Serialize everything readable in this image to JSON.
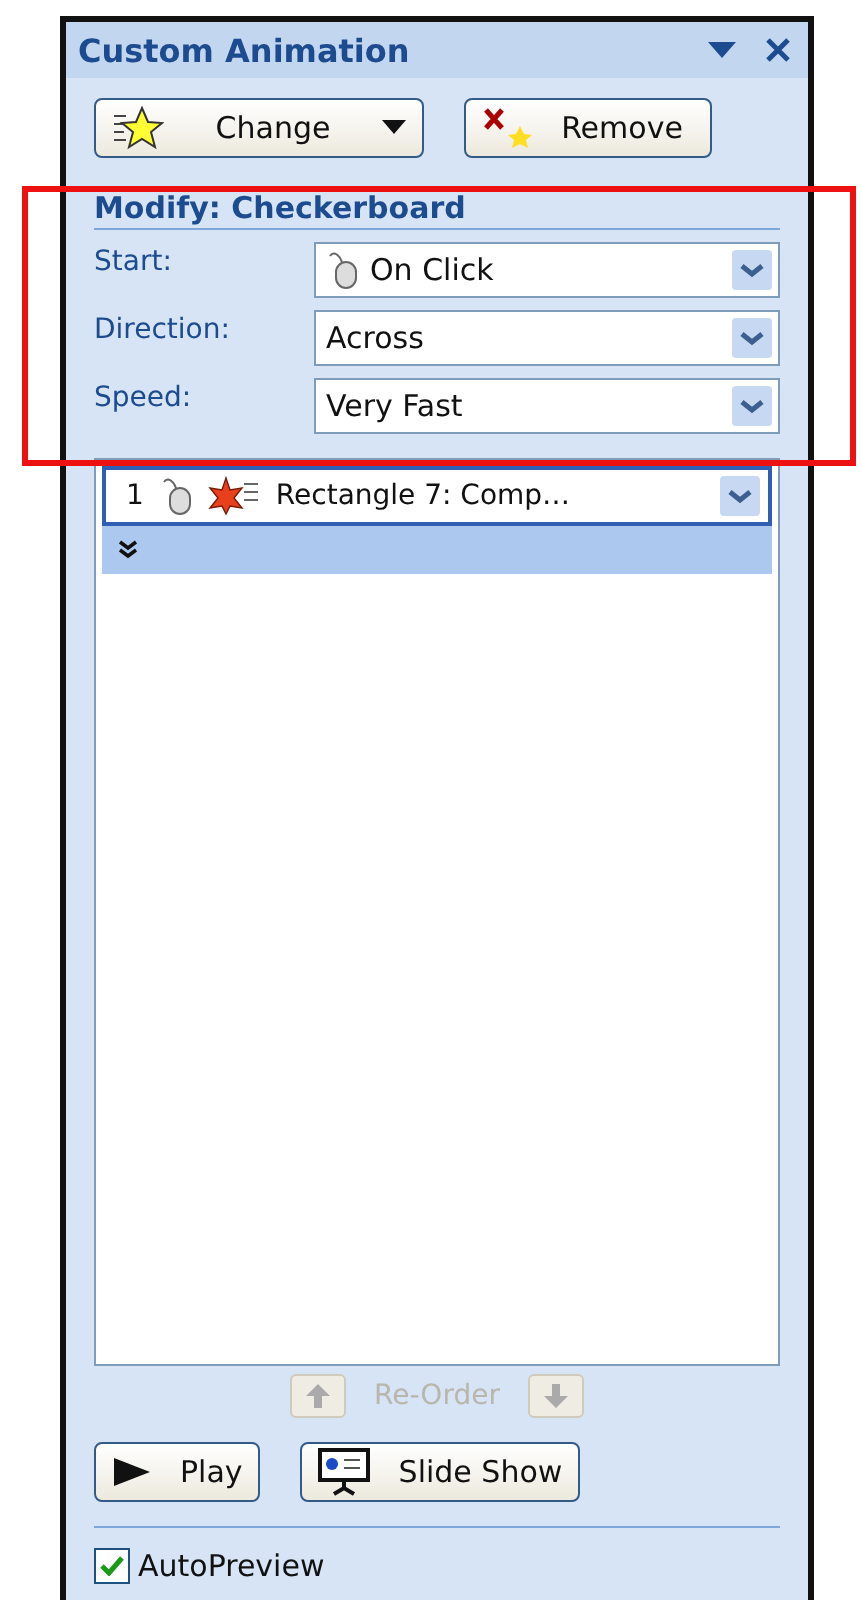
{
  "pane": {
    "title": "Custom Animation"
  },
  "actions": [
    {
      "kind": "change",
      "label": "Change",
      "dropdown": true
    },
    {
      "kind": "remove",
      "label": "Remove",
      "dropdown": false
    }
  ],
  "modify": {
    "heading": "Modify: Checkerboard",
    "fields": [
      {
        "kind": "trigger",
        "label": "Start:",
        "value": "On Click"
      },
      {
        "kind": "plain",
        "label": "Direction:",
        "value": "Across"
      },
      {
        "kind": "plain",
        "label": "Speed:",
        "value": "Very Fast"
      }
    ]
  },
  "list": {
    "items": [
      {
        "number": "1",
        "name": "Rectangle 7: Comp…",
        "selected": true
      }
    ]
  },
  "reorder": {
    "label": "Re-Order",
    "disabled": true
  },
  "playback": [
    {
      "kind": "play",
      "label": "Play"
    },
    {
      "kind": "slideshow",
      "label": "Slide Show"
    }
  ],
  "autopreview": {
    "label": "AutoPreview",
    "checked": true
  },
  "highlight": {
    "shown": true
  }
}
